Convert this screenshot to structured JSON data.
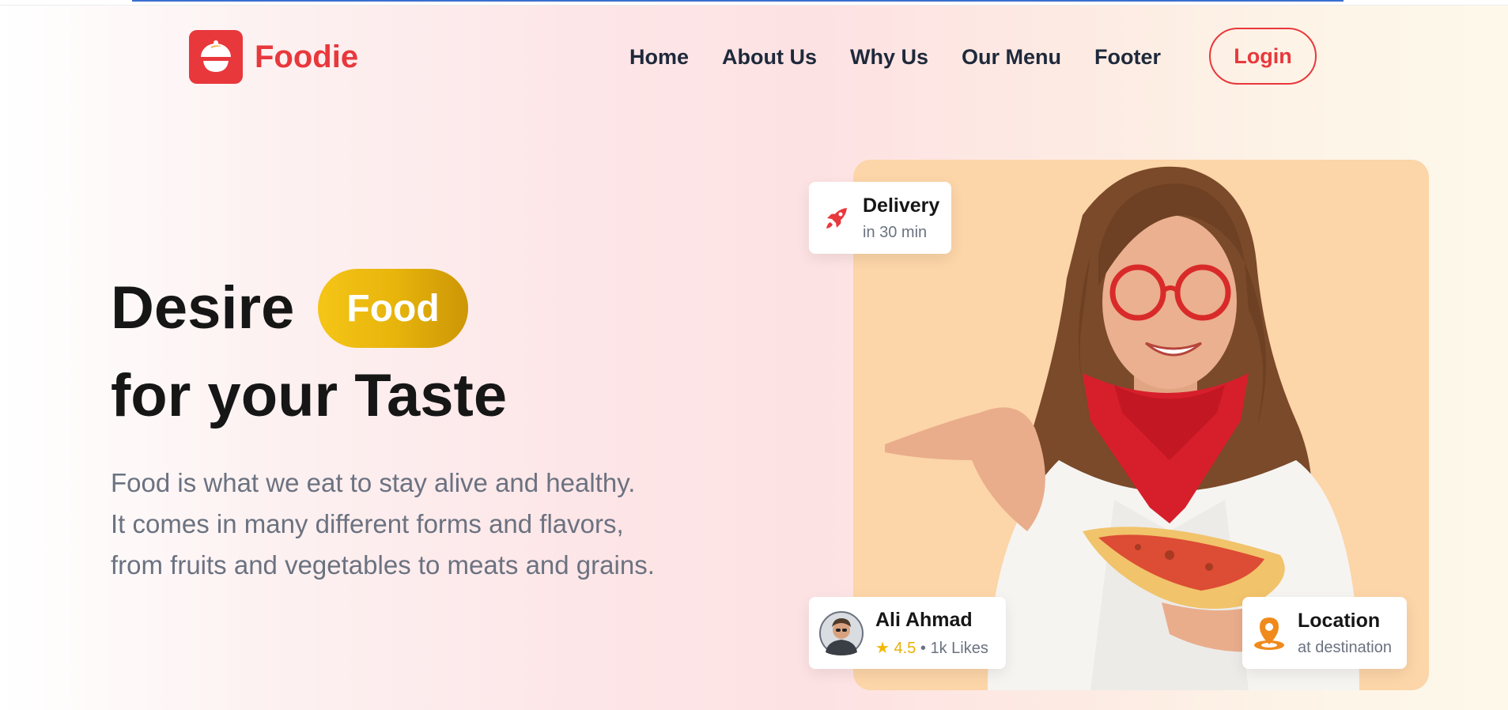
{
  "brand": {
    "name": "Foodie",
    "accent": "#e8383c"
  },
  "nav": {
    "items": [
      "Home",
      "About Us",
      "Why Us",
      "Our Menu",
      "Footer"
    ],
    "login_label": "Login"
  },
  "hero": {
    "headline_word": "Desire",
    "highlight": "Food",
    "headline_line2": "for your Taste",
    "description_lines": [
      "Food is what we eat to stay alive and healthy.",
      "It comes in many different forms and flavors,",
      "from fruits and vegetables to meats and grains."
    ],
    "highlight_color": "#f0bd11"
  },
  "cards": {
    "delivery": {
      "title": "Delivery",
      "subtitle": "in 30 min",
      "icon": "rocket-icon"
    },
    "reviewer": {
      "name": "Ali Ahmad",
      "star": "★",
      "rating": "4.5",
      "separator": "•",
      "likes": "1k Likes",
      "icon": "avatar"
    },
    "location": {
      "title": "Location",
      "subtitle": "at destination",
      "icon": "location-pin-icon"
    }
  },
  "colors": {
    "heading": "#161616",
    "muted": "#6b7280",
    "photo_bg": "#fcd5a8"
  }
}
